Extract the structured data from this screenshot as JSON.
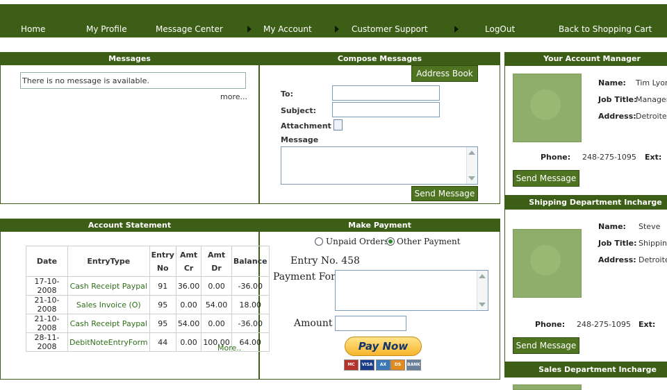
{
  "nav": {
    "items": [
      "Home",
      "My Profile",
      "Message Center",
      "My Account",
      "Customer Support",
      "LogOut",
      "Back to Shopping Cart"
    ]
  },
  "messages": {
    "title": "Messages",
    "empty_text": "There is no message is available.",
    "more": "more..."
  },
  "compose": {
    "title": "Compose Messages",
    "address_book": "Address Book",
    "to_label": "To:",
    "subject_label": "Subject:",
    "attachment_label": "Attachment :",
    "message_label": "Message",
    "send": "Send Message",
    "to_value": "",
    "subject_value": "",
    "message_value": ""
  },
  "statement": {
    "title": "Account Statement",
    "headers": {
      "date": "Date",
      "entrytype": "EntryType",
      "entry1": "Entry",
      "entry2": "No",
      "amtcr1": "Amt",
      "amtcr2": "Cr",
      "amtdr1": "Amt",
      "amtdr2": "Dr",
      "balance": "Balance"
    },
    "rows": [
      {
        "date": "17-10-2008",
        "type": "Cash Receipt Paypal",
        "no": "91",
        "cr": "36.00",
        "dr": "0.00",
        "balance": "-36.00"
      },
      {
        "date": "21-10-2008",
        "type": "Sales Invoice (O)",
        "no": "95",
        "cr": "0.00",
        "dr": "54.00",
        "balance": "18.00"
      },
      {
        "date": "21-10-2008",
        "type": "Cash Receipt Paypal",
        "no": "95",
        "cr": "54.00",
        "dr": "0.00",
        "balance": "-36.00"
      },
      {
        "date": "28-11-2008",
        "type": "DebitNoteEntryForm",
        "no": "44",
        "cr": "0.00",
        "dr": "100.00",
        "balance": "64.00"
      }
    ],
    "more": "More.."
  },
  "payment": {
    "title": "Make Payment",
    "opt_unpaid": "Unpaid Orders",
    "opt_other": "Other Payment",
    "selected": "Other Payment",
    "entry_text": "Entry No. 458",
    "payment_for_label": "Payment For :",
    "amount_label": "Amount :",
    "amount_value": "",
    "pay_now": "Pay Now",
    "cards": [
      "MasterCard",
      "VISA",
      "AMEX",
      "DISCOVER",
      "BANK"
    ]
  },
  "account_manager": {
    "title": "Your Account Manager",
    "name_label": "Name:",
    "name": "Tim Lyon",
    "job_label": "Job Title:",
    "job": "Manager",
    "address_label": "Address:",
    "address": "Detroite,",
    "phone_label": "Phone:",
    "phone": "248-275-1095",
    "ext_label": "Ext:",
    "send": "Send Message"
  },
  "shipping": {
    "title": "Shipping Department Incharge",
    "name_label": "Name:",
    "name": "Steve",
    "job_label": "Job Title:",
    "job": "Shipping",
    "address_label": "Address:",
    "address": "Detroite,",
    "phone_label": "Phone:",
    "phone": "248-275-1095",
    "ext_label": "Ext:",
    "send": "Send Message"
  },
  "sales": {
    "title": "Sales Department Incharge"
  },
  "colors": {
    "brand_green": "#3d5e17",
    "button_green": "#4e7422",
    "link_green": "#2e6e1a"
  }
}
